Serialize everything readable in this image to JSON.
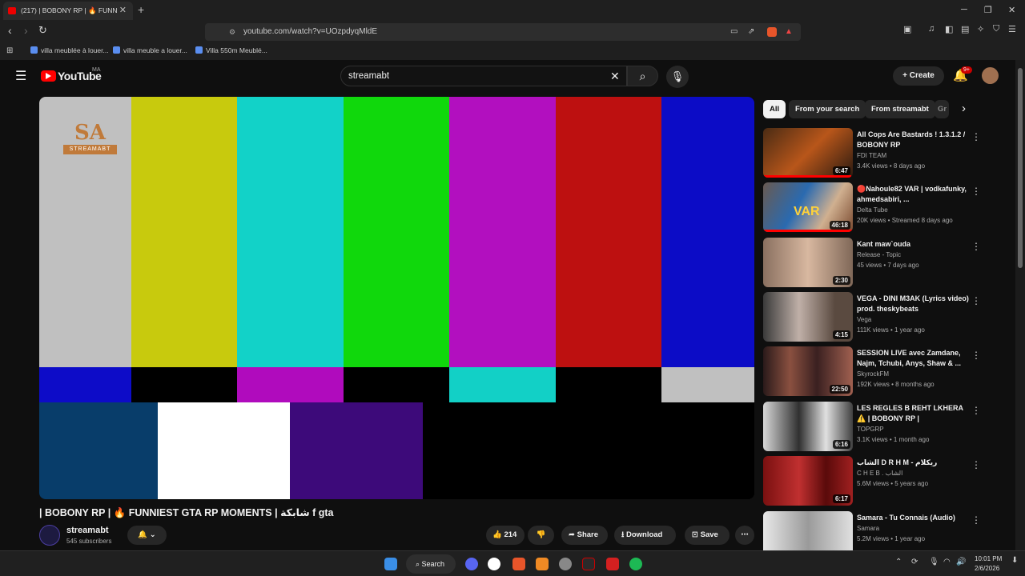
{
  "browser": {
    "tab_title": "(217) | BOBONY RP | 🔥 FUNN",
    "url": "youtube.com/watch?v=UOzpdyqMldE",
    "bookmarks": [
      "villa meublée à louer...",
      "villa meuble a louer...",
      "Villa 550m Meublé..."
    ]
  },
  "youtube": {
    "logo": "YouTube",
    "region": "MA",
    "search_value": "streamabt",
    "create_label": "Create",
    "notif_count": "9+",
    "video": {
      "title": "| BOBONY RP | 🔥 FUNNIEST GTA RP MOMENTS | شابكة f gta",
      "channel": "streamabt",
      "subscribers": "545 subscribers",
      "likes": "214",
      "share_label": "Share",
      "download_label": "Download",
      "save_label": "Save",
      "watermark": "SA",
      "watermark_sub": "STREAMABT"
    },
    "chips": [
      "All",
      "From your search",
      "From streamabt",
      "Gr"
    ],
    "recommendations": [
      {
        "title": "All Cops Are Bastards ! 1.3.1.2 / BOBONY RP",
        "channel": "FDI TEAM",
        "meta": "3.4K views • 8 days ago",
        "duration": "6:47"
      },
      {
        "title": "🔴Nahoule82 VAR | vodkafunky, ahmedsabiri, ...",
        "channel": "Delta Tube",
        "meta": "20K views • Streamed 8 days ago",
        "duration": "46:18"
      },
      {
        "title": "Kant maw`ouda",
        "channel": "Release - Topic",
        "meta": "45 views • 7 days ago",
        "duration": "2:30"
      },
      {
        "title": "VEGA - DINI M3AK (Lyrics video) prod. theskybeats",
        "channel": "Vega",
        "meta": "111K views • 1 year ago",
        "duration": "4:15"
      },
      {
        "title": "SESSION LIVE avec Zamdane, Najm, Tchubi, Anys, Shaw & ...",
        "channel": "SkyrockFM",
        "meta": "192K views • 8 months ago",
        "duration": "22:50"
      },
      {
        "title": "LES REGLES B REHT LKHERA ⚠️ | BOBONY RP |",
        "channel": "TOPGRP",
        "meta": "3.1K views • 1 month ago",
        "duration": "6:16"
      },
      {
        "title": "الشاب D R H M - ريكلام",
        "channel": "C H E B . الشاب",
        "meta": "5.6M views • 5 years ago",
        "duration": "6:17"
      },
      {
        "title": "Samara - Tu Connais (Audio)",
        "channel": "Samara",
        "meta": "5.2M views • 1 year ago",
        "duration": ""
      }
    ]
  },
  "taskbar": {
    "search_label": "Search",
    "time": "10:01 PM",
    "date": "2/6/2026"
  },
  "colors": {
    "accent": "#ff0000",
    "bg": "#0f0f0f"
  }
}
